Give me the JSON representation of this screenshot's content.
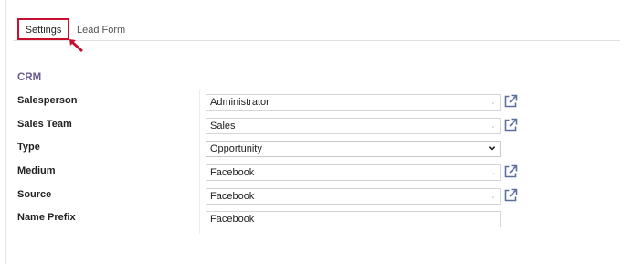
{
  "tabs": [
    {
      "label": "Settings"
    },
    {
      "label": "Lead Form"
    }
  ],
  "section": {
    "title": "CRM"
  },
  "fields": [
    {
      "label": "Salesperson",
      "value": "Administrator",
      "kind": "many2one"
    },
    {
      "label": "Sales Team",
      "value": "Sales",
      "kind": "many2one"
    },
    {
      "label": "Type",
      "value": "Opportunity",
      "kind": "select"
    },
    {
      "label": "Medium",
      "value": "Facebook",
      "kind": "many2one"
    },
    {
      "label": "Source",
      "value": "Facebook",
      "kind": "many2one"
    },
    {
      "label": "Name Prefix",
      "value": "Facebook",
      "kind": "text"
    }
  ],
  "colors": {
    "highlight_border": "#c8102e",
    "section_title": "#6a5c8f",
    "external_link_icon": "#5c6f9e"
  },
  "icons": {
    "external_link": "external-link-icon",
    "dropdown": "chevron-down-icon",
    "annotation": "arrow-pointer-icon"
  }
}
